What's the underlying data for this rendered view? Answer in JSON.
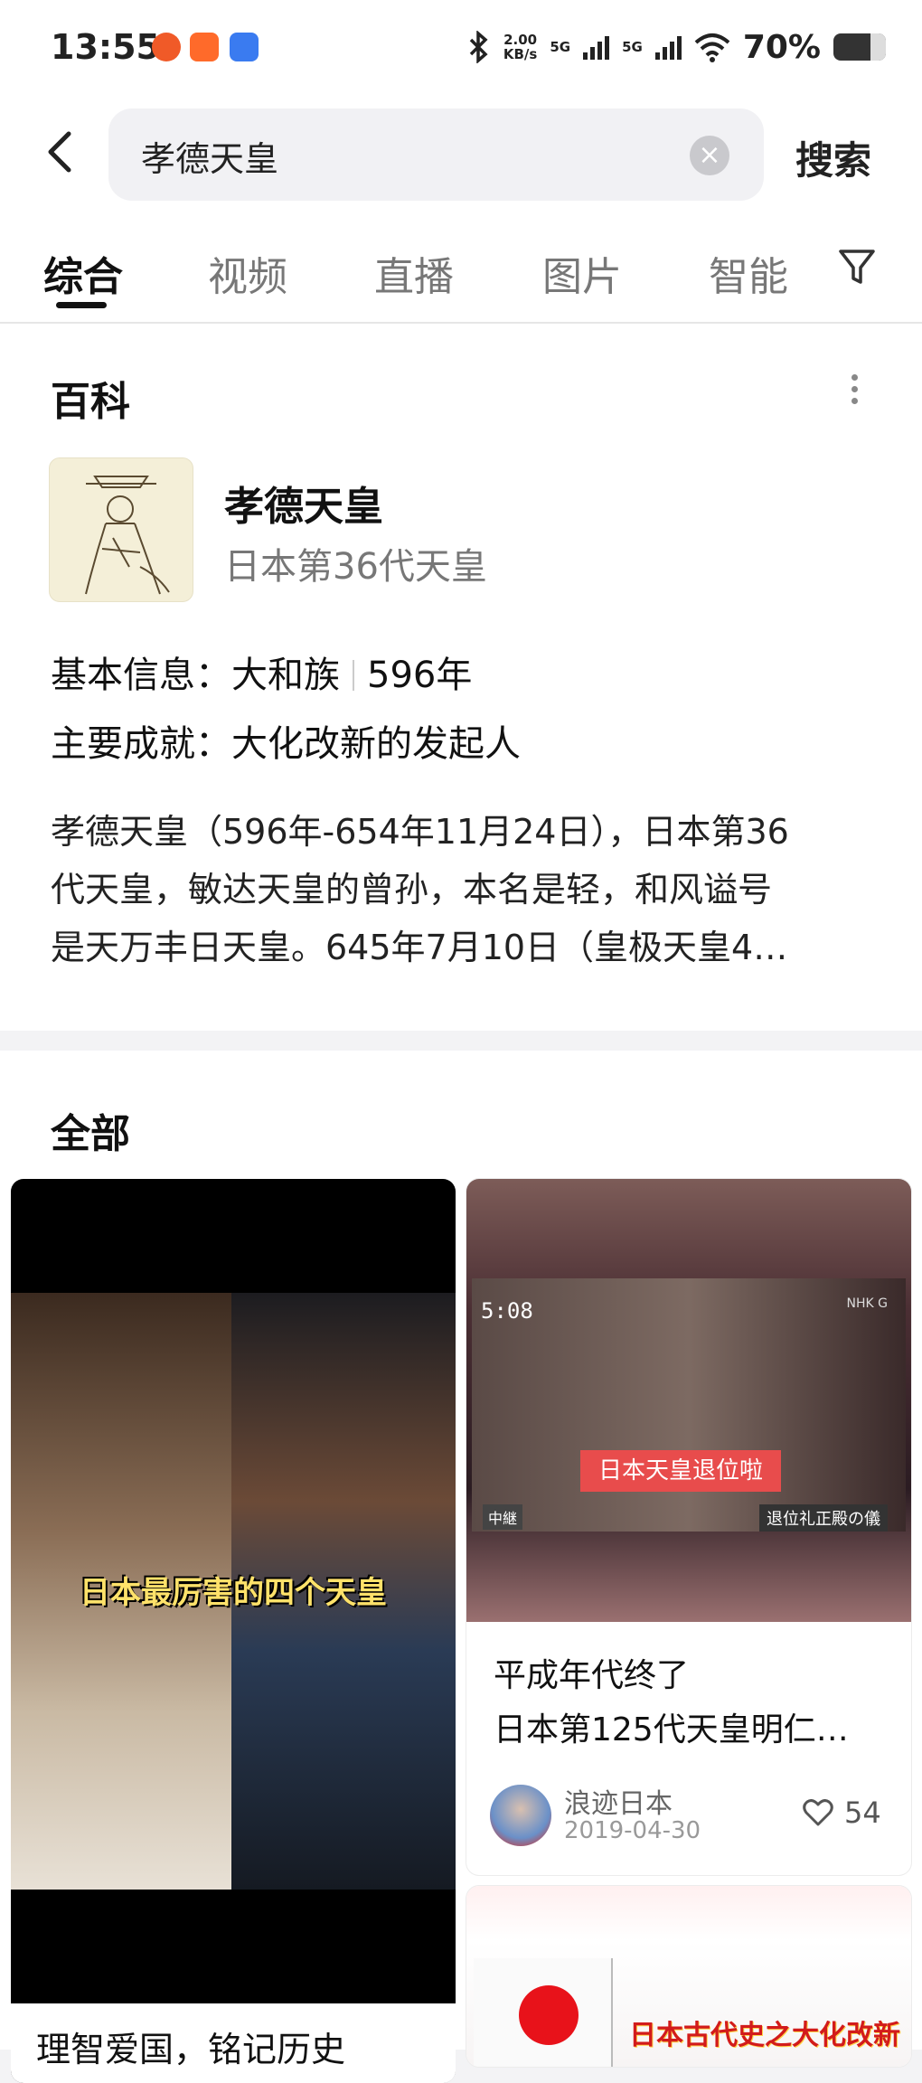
{
  "status_bar": {
    "time": "13:55",
    "net_speed_value": "2.00",
    "net_speed_unit": "KB/s",
    "signal1": "5G",
    "signal2": "5G",
    "battery": "70%",
    "battery_level": 0.7
  },
  "search": {
    "query": "孝德天皇",
    "button": "搜索"
  },
  "tabs": [
    "综合",
    "视频",
    "直播",
    "图片",
    "智能"
  ],
  "baike": {
    "section_title": "百科",
    "entry_name": "孝德天皇",
    "entry_subtitle": "日本第36代天皇",
    "basic_label": "基本信息：",
    "basic_value_1": "大和族",
    "basic_value_2": "596年",
    "achieve_label": "主要成就：",
    "achieve_value": "大化改新的发起人",
    "desc_lines": [
      "孝德天皇（596年-654年11月24日），日本第36",
      "代天皇，敏达天皇的曾孙，本名是轻，和风谥号",
      "是天万丰日天皇。645年7月10日（皇极天皇4…"
    ]
  },
  "all": {
    "section_title": "全部",
    "card1": {
      "video_caption": "日本最厉害的四个天皇",
      "title": "理智爱国，铭记历史"
    },
    "card2": {
      "video_time": "5:08",
      "video_logo": "NHK G",
      "video_overlay": "日本天皇退位啦",
      "video_lower_left": "中継",
      "video_lower_right": "退位礼正殿の儀",
      "title_lines": [
        "平成年代终了",
        "日本第125代天皇明仁…"
      ],
      "author": "浪迹日本",
      "date": "2019-04-30",
      "likes": "54"
    },
    "card3": {
      "video_caption": "日本古代史之大化改新"
    }
  }
}
